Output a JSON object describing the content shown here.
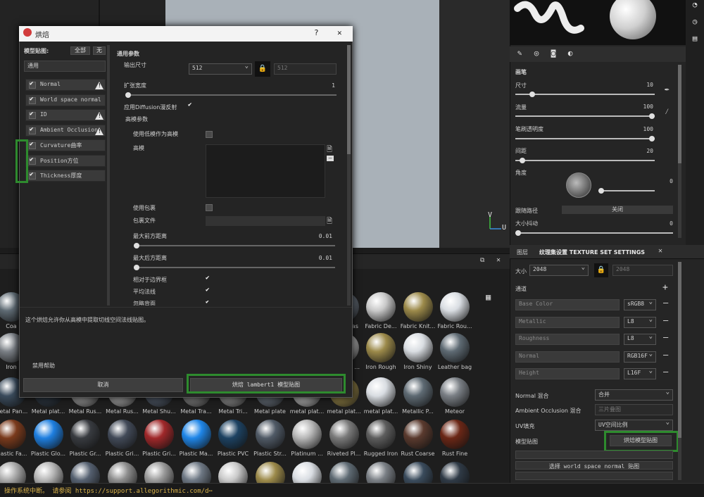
{
  "viewport": {
    "axis_v": "V",
    "axis_u": "U"
  },
  "shelf": {
    "header_icons": [
      "restore-icon",
      "close-icon"
    ],
    "rows": [
      [
        "Coa",
        "",
        "",
        "",
        "",
        "",
        "",
        "",
        "",
        "Fabric Bas",
        "Fabric De...",
        "Fabric Knit...",
        "Fabric Rou..."
      ],
      [
        "Iron",
        "",
        "",
        "",
        "",
        "",
        "",
        "",
        "",
        "Iron Raw ...",
        "Iron Rough",
        "Iron Shiny",
        "Leather bag"
      ],
      [
        "Metal Pan...",
        "Metal plat...",
        "Metal Rus...",
        "Metal Rus...",
        "Metal Shu...",
        "Metal Tra...",
        "Metal Tri...",
        "Metal plate",
        "metal plat...",
        "metal plat...",
        "metal plat...",
        "Metallic P...",
        "Meteor"
      ],
      [
        "Plastic Fa...",
        "Plastic Glo...",
        "Plastic Gr...",
        "Plastic Gri...",
        "Plastic Gri...",
        "Plastic Ma...",
        "Plastic PVC",
        "Plastic Str...",
        "Platinum ...",
        "Riveted Pl...",
        "Rugged Iron",
        "Rust Coarse",
        "Rust Fine"
      ],
      [
        "",
        "",
        "",
        "",
        "",
        "",
        "",
        "",
        "",
        "",
        "",
        "",
        ""
      ]
    ]
  },
  "status": {
    "text": "操作系统中断。 请参阅 https://support.allegorithmic.com/d⋯"
  },
  "brush": {
    "title": "画笔",
    "size_label": "尺寸",
    "size_value": "10",
    "size_pct": 0.12,
    "flow_label": "流量",
    "flow_value": "100",
    "flow_pct": 1.0,
    "stroke_opacity_label": "笔刷透明度",
    "stroke_opacity_value": "100",
    "stroke_opacity_pct": 1.0,
    "spacing_label": "间距",
    "spacing_value": "20",
    "spacing_pct": 0.05,
    "angle_label": "角度",
    "angle_value": "0",
    "follow_path_label": "跟随路径",
    "follow_path_value": "关闭",
    "size_jitter_label": "大小抖动",
    "size_jitter_value": "0",
    "size_jitter_pct": 0.0
  },
  "texset": {
    "tab_layers": "图层",
    "tab_settings": "纹理集设置 TEXTURE SET SETTINGS",
    "size_label": "大小",
    "size_value": "2048",
    "size_linked": "2048",
    "channels_label": "通道",
    "channels": [
      {
        "name": "Base Color",
        "format": "sRGB8"
      },
      {
        "name": "Metallic",
        "format": "L8"
      },
      {
        "name": "Roughness",
        "format": "L8"
      },
      {
        "name": "Normal",
        "format": "RGB16F"
      },
      {
        "name": "Height",
        "format": "L16F"
      }
    ],
    "normal_mix_label": "Normal 混合",
    "normal_mix_value": "合并",
    "ao_mix_label": "Ambient Occlusion 混合",
    "ao_mix_value": "三片叠图",
    "uv_label": "UV填充",
    "uv_value": "UV空间比例",
    "mesh_maps_label": "模型贴图",
    "bake_button": "烘焙模型贴图",
    "select_label": "选择 world space normal 贴图"
  },
  "dialog": {
    "title": "烘焙",
    "help": "?",
    "close": "✕",
    "mesh_maps_label": "模型贴图:",
    "all_btn": "全部",
    "none_btn": "无",
    "common": "通用",
    "items": [
      "Normal",
      "World space normal",
      "ID",
      "Ambient Occlusion",
      "Curvature曲率",
      "Position方位",
      "Thickness厚度"
    ],
    "section": "通用参数",
    "out_size_label": "输出尺寸",
    "out_size_value": "512",
    "out_size_linked": "512",
    "dilation_label": "扩张宽度",
    "dilation_value": "1",
    "diffusion_label": "应用Diffusion漫反射",
    "highpoly_label": "高模参数",
    "use_lowpoly_label": "使用低模作为高模",
    "highpoly_meshes_label": "高模",
    "use_cage_label": "使用包裹",
    "cage_file_label": "包裹文件",
    "max_front_label": "最大前方距离",
    "max_front_value": "0.01",
    "max_rear_label": "最大后方距离",
    "max_rear_value": "0.01",
    "relative_label": "相对于边界框",
    "average_label": "平均法线",
    "ignore_label": "忽略背面",
    "description": "这个烘焙允许你从高模中提取切线空间法线贴图。",
    "disable_help": "禁用帮助",
    "cancel": "取消",
    "bake": "烘焙 lambert1 模型贴图"
  }
}
